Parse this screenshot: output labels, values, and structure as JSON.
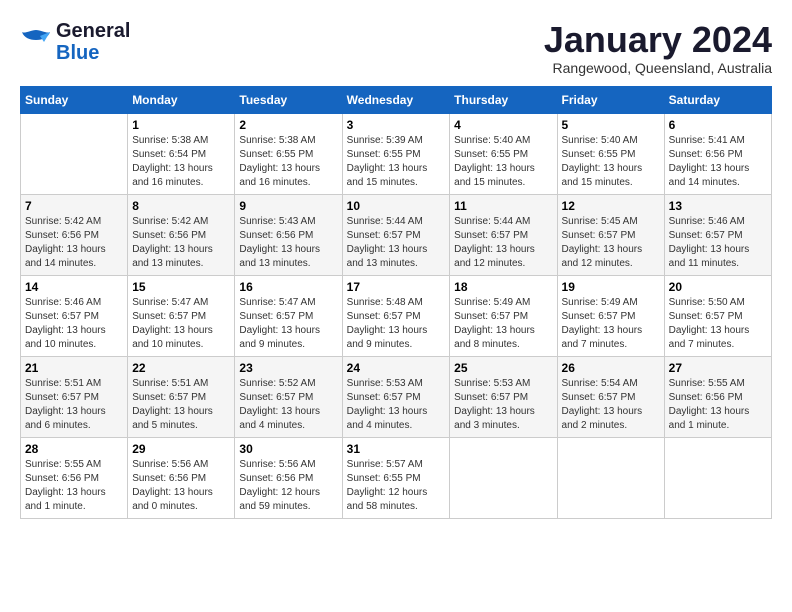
{
  "logo": {
    "line1": "General",
    "line2": "Blue"
  },
  "title": "January 2024",
  "location": "Rangewood, Queensland, Australia",
  "days_header": [
    "Sunday",
    "Monday",
    "Tuesday",
    "Wednesday",
    "Thursday",
    "Friday",
    "Saturday"
  ],
  "weeks": [
    [
      {
        "day": "",
        "info": ""
      },
      {
        "day": "1",
        "info": "Sunrise: 5:38 AM\nSunset: 6:54 PM\nDaylight: 13 hours\nand 16 minutes."
      },
      {
        "day": "2",
        "info": "Sunrise: 5:38 AM\nSunset: 6:55 PM\nDaylight: 13 hours\nand 16 minutes."
      },
      {
        "day": "3",
        "info": "Sunrise: 5:39 AM\nSunset: 6:55 PM\nDaylight: 13 hours\nand 15 minutes."
      },
      {
        "day": "4",
        "info": "Sunrise: 5:40 AM\nSunset: 6:55 PM\nDaylight: 13 hours\nand 15 minutes."
      },
      {
        "day": "5",
        "info": "Sunrise: 5:40 AM\nSunset: 6:55 PM\nDaylight: 13 hours\nand 15 minutes."
      },
      {
        "day": "6",
        "info": "Sunrise: 5:41 AM\nSunset: 6:56 PM\nDaylight: 13 hours\nand 14 minutes."
      }
    ],
    [
      {
        "day": "7",
        "info": "Sunrise: 5:42 AM\nSunset: 6:56 PM\nDaylight: 13 hours\nand 14 minutes."
      },
      {
        "day": "8",
        "info": "Sunrise: 5:42 AM\nSunset: 6:56 PM\nDaylight: 13 hours\nand 13 minutes."
      },
      {
        "day": "9",
        "info": "Sunrise: 5:43 AM\nSunset: 6:56 PM\nDaylight: 13 hours\nand 13 minutes."
      },
      {
        "day": "10",
        "info": "Sunrise: 5:44 AM\nSunset: 6:57 PM\nDaylight: 13 hours\nand 13 minutes."
      },
      {
        "day": "11",
        "info": "Sunrise: 5:44 AM\nSunset: 6:57 PM\nDaylight: 13 hours\nand 12 minutes."
      },
      {
        "day": "12",
        "info": "Sunrise: 5:45 AM\nSunset: 6:57 PM\nDaylight: 13 hours\nand 12 minutes."
      },
      {
        "day": "13",
        "info": "Sunrise: 5:46 AM\nSunset: 6:57 PM\nDaylight: 13 hours\nand 11 minutes."
      }
    ],
    [
      {
        "day": "14",
        "info": "Sunrise: 5:46 AM\nSunset: 6:57 PM\nDaylight: 13 hours\nand 10 minutes."
      },
      {
        "day": "15",
        "info": "Sunrise: 5:47 AM\nSunset: 6:57 PM\nDaylight: 13 hours\nand 10 minutes."
      },
      {
        "day": "16",
        "info": "Sunrise: 5:47 AM\nSunset: 6:57 PM\nDaylight: 13 hours\nand 9 minutes."
      },
      {
        "day": "17",
        "info": "Sunrise: 5:48 AM\nSunset: 6:57 PM\nDaylight: 13 hours\nand 9 minutes."
      },
      {
        "day": "18",
        "info": "Sunrise: 5:49 AM\nSunset: 6:57 PM\nDaylight: 13 hours\nand 8 minutes."
      },
      {
        "day": "19",
        "info": "Sunrise: 5:49 AM\nSunset: 6:57 PM\nDaylight: 13 hours\nand 7 minutes."
      },
      {
        "day": "20",
        "info": "Sunrise: 5:50 AM\nSunset: 6:57 PM\nDaylight: 13 hours\nand 7 minutes."
      }
    ],
    [
      {
        "day": "21",
        "info": "Sunrise: 5:51 AM\nSunset: 6:57 PM\nDaylight: 13 hours\nand 6 minutes."
      },
      {
        "day": "22",
        "info": "Sunrise: 5:51 AM\nSunset: 6:57 PM\nDaylight: 13 hours\nand 5 minutes."
      },
      {
        "day": "23",
        "info": "Sunrise: 5:52 AM\nSunset: 6:57 PM\nDaylight: 13 hours\nand 4 minutes."
      },
      {
        "day": "24",
        "info": "Sunrise: 5:53 AM\nSunset: 6:57 PM\nDaylight: 13 hours\nand 4 minutes."
      },
      {
        "day": "25",
        "info": "Sunrise: 5:53 AM\nSunset: 6:57 PM\nDaylight: 13 hours\nand 3 minutes."
      },
      {
        "day": "26",
        "info": "Sunrise: 5:54 AM\nSunset: 6:57 PM\nDaylight: 13 hours\nand 2 minutes."
      },
      {
        "day": "27",
        "info": "Sunrise: 5:55 AM\nSunset: 6:56 PM\nDaylight: 13 hours\nand 1 minute."
      }
    ],
    [
      {
        "day": "28",
        "info": "Sunrise: 5:55 AM\nSunset: 6:56 PM\nDaylight: 13 hours\nand 1 minute."
      },
      {
        "day": "29",
        "info": "Sunrise: 5:56 AM\nSunset: 6:56 PM\nDaylight: 13 hours\nand 0 minutes."
      },
      {
        "day": "30",
        "info": "Sunrise: 5:56 AM\nSunset: 6:56 PM\nDaylight: 12 hours\nand 59 minutes."
      },
      {
        "day": "31",
        "info": "Sunrise: 5:57 AM\nSunset: 6:55 PM\nDaylight: 12 hours\nand 58 minutes."
      },
      {
        "day": "",
        "info": ""
      },
      {
        "day": "",
        "info": ""
      },
      {
        "day": "",
        "info": ""
      }
    ]
  ]
}
